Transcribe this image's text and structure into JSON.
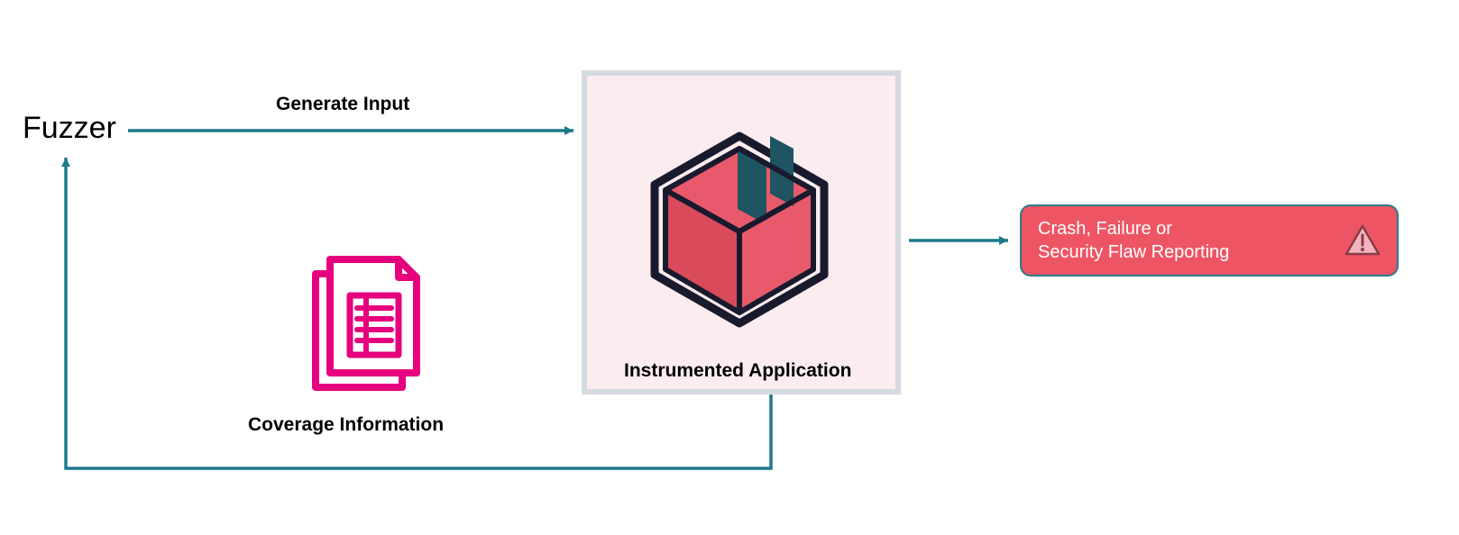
{
  "nodes": {
    "fuzzer": "Fuzzer",
    "generate_input": "Generate Input",
    "coverage_info": "Coverage Information",
    "instrumented_app": "Instrumented Application",
    "crash_report": "Crash, Failure or\nSecurity Flaw Reporting"
  },
  "colors": {
    "arrow": "#1f7a8c",
    "box_border": "#d5dae0",
    "box_fill": "#fbecef",
    "crash_fill": "#ed5565",
    "crash_border": "#2c7a8b",
    "doc_icon": "#e6007e",
    "pkg_face": "#e85a6b",
    "pkg_dark": "#1f5562",
    "pkg_outline": "#1a1a2e"
  }
}
